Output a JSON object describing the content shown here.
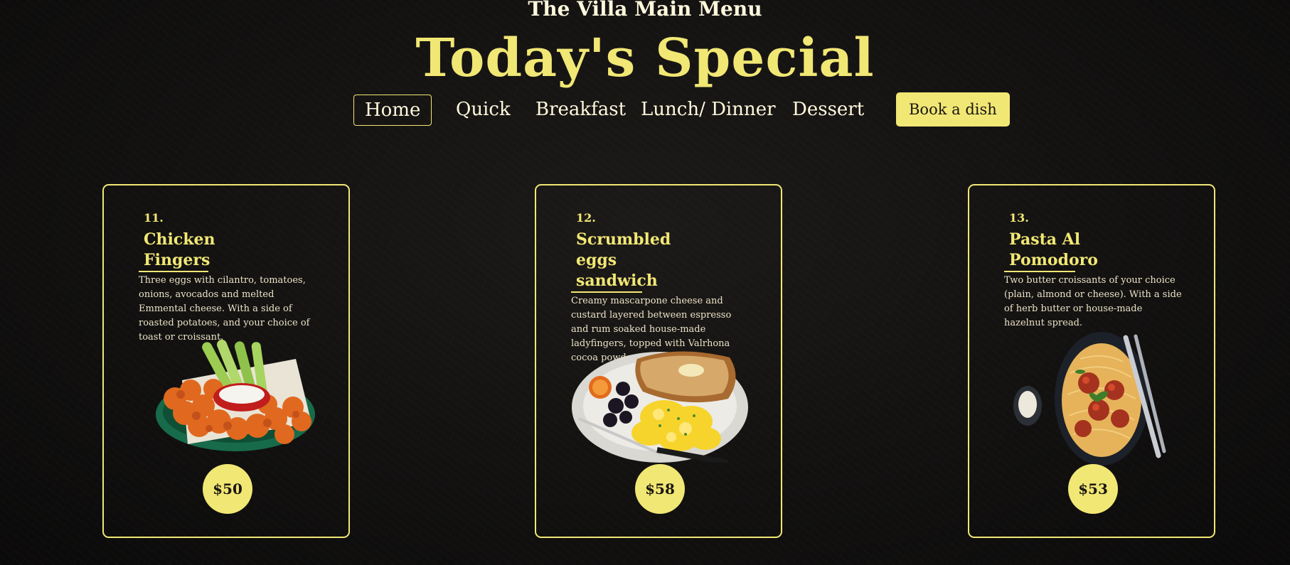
{
  "header": {
    "site_title": "The Villa Main Menu",
    "headline": "Today's Special"
  },
  "nav": {
    "items": [
      "Home",
      "Quick",
      "Breakfast",
      "Lunch/ Dinner",
      "Dessert"
    ],
    "active": "Home",
    "book_label": "Book a dish"
  },
  "cards": [
    {
      "number": "11.",
      "name_line1": "Chicken",
      "name_line2": "Fingers",
      "name_line3": "",
      "description": "Three eggs with cilantro, tomatoes, onions, avocados and melted Emmental cheese. With a side of roasted potatoes, and your choice of toast or croissant.",
      "image": "chicken-wings-icon",
      "price": "$50"
    },
    {
      "number": "12.",
      "name_line1": "Scrumbled",
      "name_line2": "eggs",
      "name_line3": "sandwich",
      "description": "Creamy mascarpone cheese and custard layered between espresso and rum soaked house-made ladyfingers, topped with Valrhona cocoa powder.",
      "image": "scrambled-eggs-plate-icon",
      "price": "$58"
    },
    {
      "number": "13.",
      "name_line1": "Pasta Al",
      "name_line2": "Pomodoro",
      "name_line3": "",
      "description": "Two butter croissants of your choice (plain, almond or cheese). With a side of herb butter or house-made hazelnut spread.",
      "image": "spaghetti-meatballs-icon",
      "price": "$53"
    }
  ],
  "colors": {
    "accent": "#f1e774",
    "background": "#121110",
    "text_light": "#fff8dc"
  }
}
